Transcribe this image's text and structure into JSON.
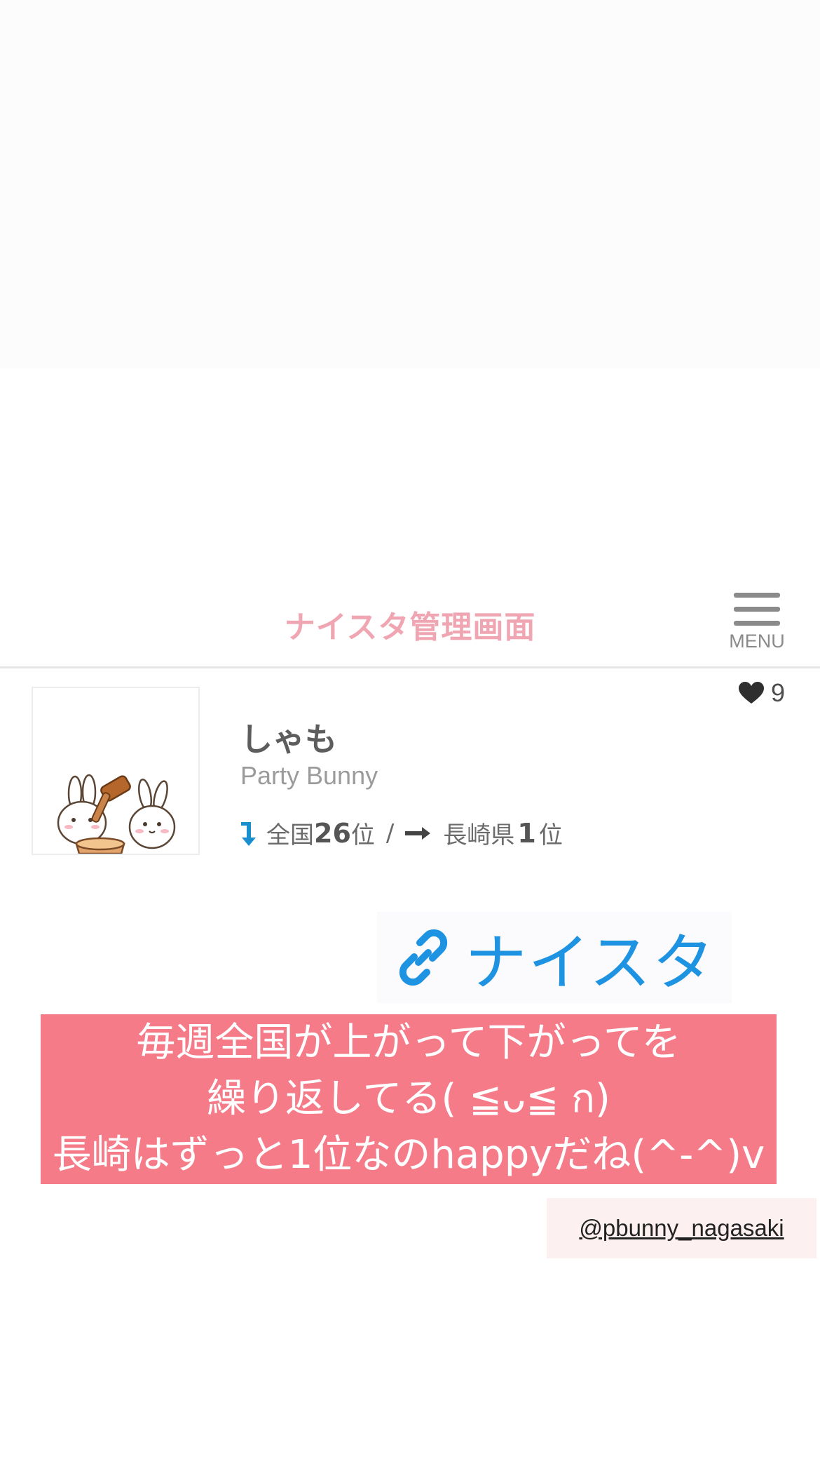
{
  "header": {
    "title": "ナイスタ管理画面",
    "menu_label": "MENU"
  },
  "profile": {
    "name": "しゃも",
    "shop": "Party Bunny",
    "likes": "9",
    "rank": {
      "national_prefix": "全国",
      "national_number": "26",
      "national_suffix": "位",
      "national_trend": "down",
      "separator": "/",
      "prefecture_prefix": "長崎県",
      "prefecture_number": "1",
      "prefecture_suffix": "位",
      "prefecture_trend": "same"
    }
  },
  "link_badge": {
    "label": "ナイスタ",
    "icon": "link-icon"
  },
  "caption": {
    "lines": [
      "毎週全国が上がって下がってを",
      "繰り返してる( ≦ᴗ≦ ก)",
      "長崎はずっと1位なのhappyだね(^-^)v"
    ]
  },
  "handle": "@pbunny_nagasaki",
  "colors": {
    "title_pink": "#f0a6b2",
    "caption_bg": "#f67b89",
    "link_blue": "#1e93e2",
    "rank_down_blue": "#1a8fd0",
    "handle_bg": "#fdf0f1"
  }
}
